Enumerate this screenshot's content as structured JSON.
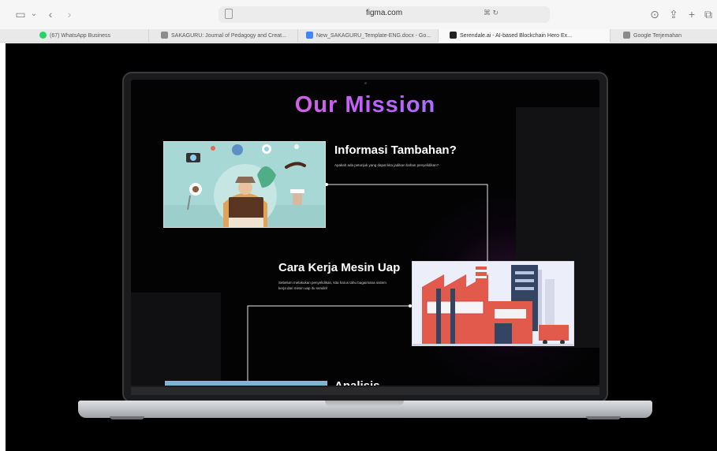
{
  "browser": {
    "url": "figma.com",
    "tabs": [
      {
        "label": "(67) WhatsApp Business",
        "color": "#25d366"
      },
      {
        "label": "SAKAGURU: Journal of Pedagogy and Creat...",
        "color": "#8c8c8c"
      },
      {
        "label": "New_SAKAGURU_Template-ENG.docx - Go...",
        "color": "#4285f4"
      },
      {
        "label": "Serendale.ai - AI-based Blockchain Hero Ex...",
        "color": "#222222",
        "active": true
      },
      {
        "label": "Google Terjemahan",
        "color": "#8a8a8a"
      }
    ]
  },
  "slide": {
    "title": "Our Mission",
    "items": [
      {
        "heading": "Informasi Tambahan?",
        "description": "Apakah ada petunjuk yang dapat kita jadikan bahan penyelidikan?"
      },
      {
        "heading": "Cara Kerja Mesin Uap",
        "description": "Sebelum melakukan penyelidikan, kita harus tahu bagaimana sistem kerja dari mesin uap itu sendiri!"
      },
      {
        "heading": "Analisis",
        "description": ""
      }
    ]
  },
  "colors": {
    "accent_start": "#ff5fa2",
    "accent_end": "#7a8bff",
    "stage": "#000000"
  }
}
